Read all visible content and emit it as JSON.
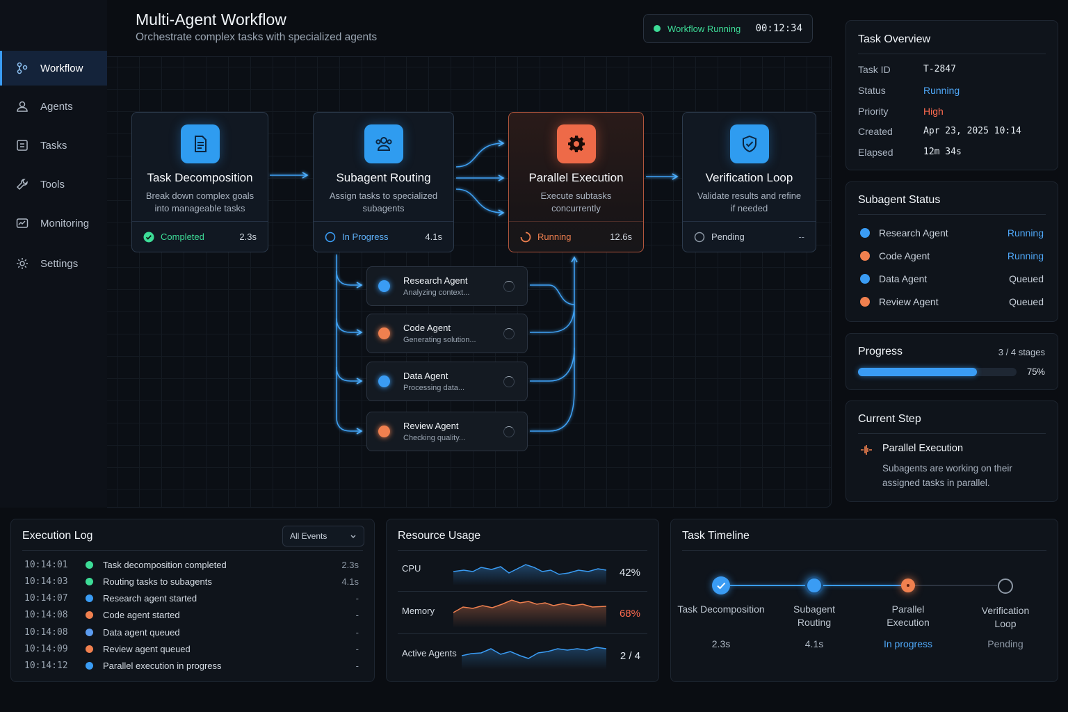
{
  "sidebar": {
    "items": [
      {
        "label": "Workflow",
        "icon": "workflow-icon"
      },
      {
        "label": "Agents",
        "icon": "user-icon"
      },
      {
        "label": "Tasks",
        "icon": "list-icon"
      },
      {
        "label": "Tools",
        "icon": "wrench-icon"
      },
      {
        "label": "Monitoring",
        "icon": "chart-icon"
      },
      {
        "label": "Settings",
        "icon": "gear-icon"
      }
    ]
  },
  "header": {
    "title": "Multi-Agent Workflow",
    "subtitle": "Orchestrate complex tasks with specialized agents",
    "status_label": "Workflow Running",
    "timer": "00:12:34"
  },
  "stages": [
    {
      "title": "Task Decomposition",
      "desc": "Break down complex goals into manageable tasks",
      "status": "Completed",
      "duration": "2.3s",
      "icon": "document-icon"
    },
    {
      "title": "Subagent Routing",
      "desc": "Assign tasks to specialized subagents",
      "status": "In Progress",
      "duration": "4.1s",
      "icon": "users-icon"
    },
    {
      "title": "Parallel Execution",
      "desc": "Execute subtasks concurrently",
      "status": "Running",
      "duration": "12.6s",
      "icon": "gear-icon"
    },
    {
      "title": "Verification Loop",
      "desc": "Validate results and refine if needed",
      "status": "Pending",
      "duration": "--",
      "icon": "shield-check-icon"
    }
  ],
  "agents": [
    {
      "name": "Research Agent",
      "activity": "Analyzing context..."
    },
    {
      "name": "Code Agent",
      "activity": "Generating solution..."
    },
    {
      "name": "Data Agent",
      "activity": "Processing data..."
    },
    {
      "name": "Review Agent",
      "activity": "Checking quality..."
    }
  ],
  "task_overview": {
    "title": "Task Overview",
    "rows": [
      {
        "label": "Task ID",
        "value": "T-2847"
      },
      {
        "label": "Status",
        "value": "Running"
      },
      {
        "label": "Priority",
        "value": "High"
      },
      {
        "label": "Created",
        "value": "Apr 23, 2025 10:14"
      },
      {
        "label": "Elapsed",
        "value": "12m 34s"
      }
    ]
  },
  "subagent_status": {
    "title": "Subagent Status",
    "rows": [
      {
        "name": "Research Agent",
        "status": "Running"
      },
      {
        "name": "Code Agent",
        "status": "Running"
      },
      {
        "name": "Data Agent",
        "status": "Queued"
      },
      {
        "name": "Review Agent",
        "status": "Queued"
      }
    ]
  },
  "progress": {
    "title": "Progress",
    "stages_text": "3 / 4 stages",
    "percent_text": "75%",
    "fraction": 0.75
  },
  "current_step": {
    "title": "Current Step",
    "step": "Parallel Execution",
    "desc": "Subagents are working on their assigned tasks in parallel."
  },
  "execution_log": {
    "title": "Execution Log",
    "filter": "All Events",
    "rows": [
      {
        "time": "10:14:01",
        "msg": "Task decomposition completed",
        "dur": "2.3s"
      },
      {
        "time": "10:14:03",
        "msg": "Routing tasks to subagents",
        "dur": "4.1s"
      },
      {
        "time": "10:14:07",
        "msg": "Research agent started",
        "dur": "-"
      },
      {
        "time": "10:14:08",
        "msg": "Code agent started",
        "dur": "-"
      },
      {
        "time": "10:14:08",
        "msg": "Data agent queued",
        "dur": "-"
      },
      {
        "time": "10:14:09",
        "msg": "Review agent queued",
        "dur": "-"
      },
      {
        "time": "10:14:12",
        "msg": "Parallel execution in progress",
        "dur": "-"
      }
    ]
  },
  "resource_usage": {
    "title": "Resource Usage",
    "rows": [
      {
        "label": "CPU",
        "value": "42%"
      },
      {
        "label": "Memory",
        "value": "68%"
      },
      {
        "label": "Active Agents",
        "value": "2 / 4"
      }
    ]
  },
  "timeline": {
    "title": "Task Timeline",
    "nodes": [
      {
        "label": "Task Decomposition",
        "sub": "2.3s"
      },
      {
        "label": "Subagent Routing",
        "sub": "4.1s"
      },
      {
        "label": "Parallel Execution",
        "sub": "In progress"
      },
      {
        "label": "Verification Loop",
        "sub": "Pending"
      }
    ]
  },
  "colors": {
    "blue": "#3a9cf4",
    "orange": "#f0804f",
    "green": "#3ddc97",
    "danger": "#ff5a4f"
  }
}
